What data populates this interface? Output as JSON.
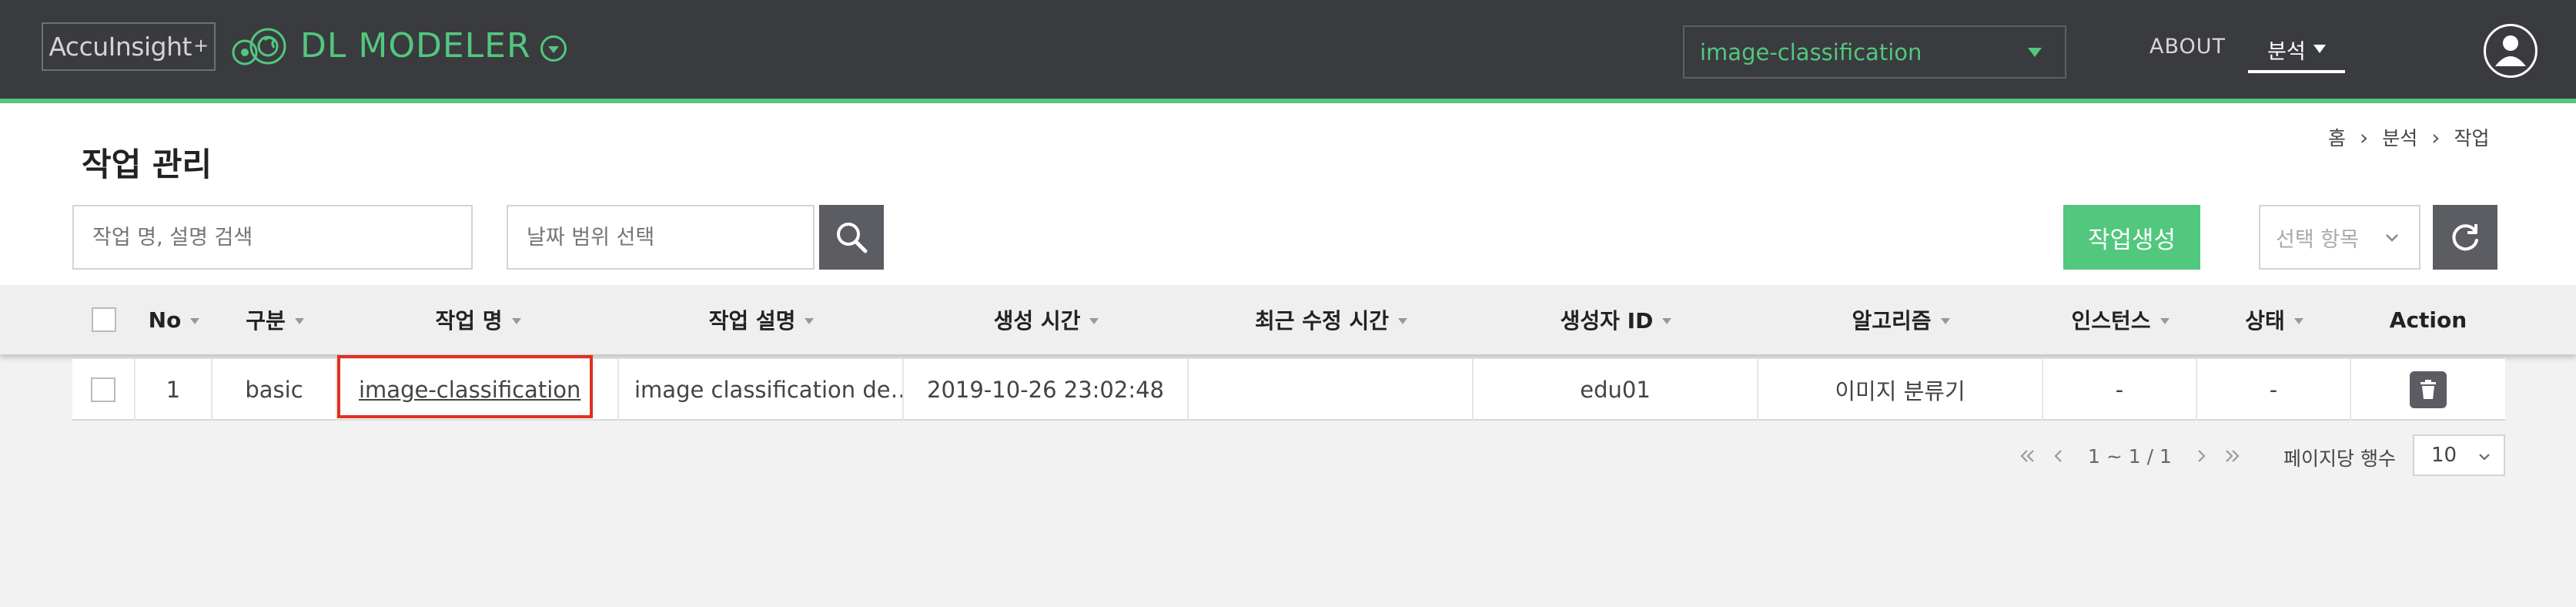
{
  "header": {
    "brand": "AccuInsight",
    "brand_plus": "+",
    "product_name": "DL MODELER",
    "project_selected": "image-classification",
    "nav": {
      "about": "ABOUT",
      "analysis": "분석"
    }
  },
  "page": {
    "title": "작업 관리",
    "breadcrumb": [
      "홈",
      "분석",
      "작업"
    ]
  },
  "toolbar": {
    "search_placeholder": "작업 명, 설명 검색",
    "date_placeholder": "날짜 범위 선택",
    "create_label": "작업생성",
    "select_items_placeholder": "선택 항목"
  },
  "table": {
    "headers": [
      "No",
      "구분",
      "작업 명",
      "작업 설명",
      "생성 시간",
      "최근 수정 시간",
      "생성자 ID",
      "알고리즘",
      "인스턴스",
      "상태",
      "Action"
    ],
    "rows": [
      {
        "no": "1",
        "type": "basic",
        "name": "image-classification",
        "description": "image classification de…",
        "created": "2019-10-26 23:02:48",
        "modified": "",
        "creator": "edu01",
        "algorithm": "이미지 분류기",
        "instance": "-",
        "status": "-"
      }
    ]
  },
  "pagination": {
    "range": "1 ~ 1 / 1",
    "rows_per_page_label": "페이지당 행수",
    "rows_per_page": "10"
  },
  "colors": {
    "accent": "#52c77e",
    "header_bg": "#3a3b3f",
    "highlight": "#e0301e"
  }
}
